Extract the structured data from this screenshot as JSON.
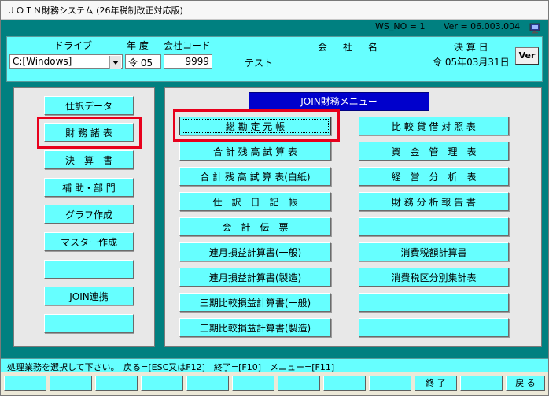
{
  "title": "ＪＯＩＮ財務システム (26年税制改正対応版)",
  "status_top": {
    "ws_no": "WS_NO = 1",
    "version": "Ver = 06.003.004"
  },
  "header": {
    "drive_label": "ドライブ",
    "nendo_label": "年 度",
    "company_code_label": "会社コード",
    "company_name_label": "会社名",
    "settlement_label": "決 算 日",
    "drive_value": "C:[Windows]",
    "nendo_value": "令 05",
    "company_code_value": "9999",
    "company_name_value": "テスト",
    "settlement_value": "令 05年03月31日",
    "ver_button": "Ver"
  },
  "left_menu": [
    {
      "label": "仕訳データ"
    },
    {
      "label": "財 務 諸 表"
    },
    {
      "label": "決　算　書"
    },
    {
      "label": "補 助・部 門"
    },
    {
      "label": "グラフ作成"
    },
    {
      "label": "マスター作成"
    },
    {
      "label": ""
    },
    {
      "label": "JOIN連携"
    },
    {
      "label": ""
    }
  ],
  "menu_title": "JOIN財務メニュー",
  "right_menu": {
    "col1": [
      {
        "label": "総 勘 定 元 帳"
      },
      {
        "label": "合 計 残 高 試 算 表"
      },
      {
        "label": "合 計 残 高 試 算 表(白紙)"
      },
      {
        "label": "仕　訳　日　記　帳"
      },
      {
        "label": "会　計　伝　票"
      },
      {
        "label": "連月損益計算書(一般)"
      },
      {
        "label": "連月損益計算書(製造)"
      },
      {
        "label": "三期比較損益計算書(一般)"
      },
      {
        "label": "三期比較損益計算書(製造)"
      }
    ],
    "col2": [
      {
        "label": "比 較 貸 借 対 照 表"
      },
      {
        "label": "資　金　管　理　表"
      },
      {
        "label": "経　営　分　析　表"
      },
      {
        "label": "財 務 分 析 報 告 書"
      },
      {
        "label": ""
      },
      {
        "label": "消費税額計算書"
      },
      {
        "label": "消費税区分別集計表"
      },
      {
        "label": ""
      },
      {
        "label": ""
      }
    ]
  },
  "statusbar": "処理業務を選択して下さい。　戻る=[ESC又はF12]　終了=[F10]　メニュー=[F11]",
  "fkeys": [
    {
      "label": ""
    },
    {
      "label": ""
    },
    {
      "label": ""
    },
    {
      "label": ""
    },
    {
      "label": ""
    },
    {
      "label": ""
    },
    {
      "label": ""
    },
    {
      "label": ""
    },
    {
      "label": ""
    },
    {
      "label": "終 了"
    },
    {
      "label": ""
    },
    {
      "label": "戻 る"
    }
  ],
  "colors": {
    "accent": "#66ffff",
    "background": "#008080",
    "menu_title": "#0000cc",
    "highlight": "#e8001c"
  }
}
